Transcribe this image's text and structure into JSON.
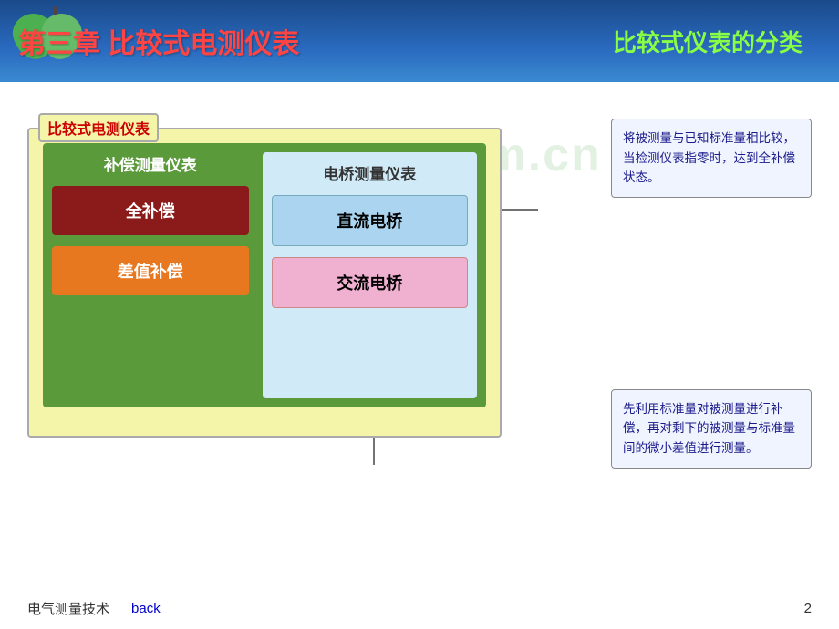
{
  "header": {
    "title_left": "第三章 比较式电测仪表",
    "title_right": "比较式仪表的分类",
    "bg_color": "#1a5599"
  },
  "watermark": {
    "text": "www.zjtchm.cn"
  },
  "diagram": {
    "outer_label": "比较式电测仪表",
    "col_left_title": "补偿测量仪表",
    "col_right_title": "电桥测量仪表",
    "btn_full": "全补偿",
    "btn_diff": "差值补偿",
    "btn_dc": "直流电桥",
    "btn_ac": "交流电桥"
  },
  "callouts": {
    "top": "将被测量与已知标准量相比较，当检测仪表指零时，达到全补偿状态。",
    "bottom": "先利用标准量对被测量进行补偿，再对剩下的被测量与标准量间的微小差值进行测量。"
  },
  "footer": {
    "left_text": "电气测量技术",
    "back_label": "back",
    "page_number": "2"
  }
}
